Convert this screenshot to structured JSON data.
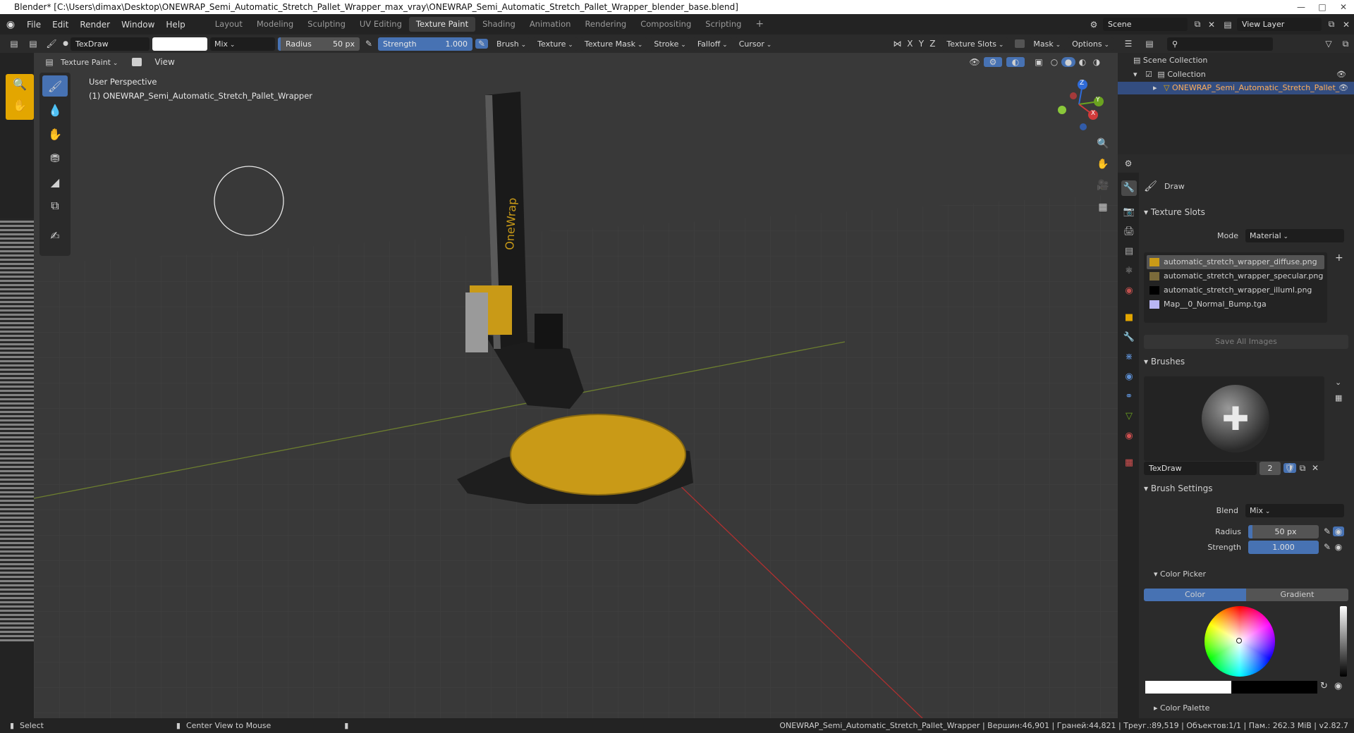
{
  "titlebar": {
    "text": "Blender* [C:\\Users\\dimax\\Desktop\\ONEWRAP_Semi_Automatic_Stretch_Pallet_Wrapper_max_vray\\ONEWRAP_Semi_Automatic_Stretch_Pallet_Wrapper_blender_base.blend]"
  },
  "menus": [
    "File",
    "Edit",
    "Render",
    "Window",
    "Help"
  ],
  "workspaces": [
    "Layout",
    "Modeling",
    "Sculpting",
    "UV Editing",
    "Texture Paint",
    "Shading",
    "Animation",
    "Rendering",
    "Compositing",
    "Scripting"
  ],
  "active_workspace": "Texture Paint",
  "scene": {
    "label": "Scene",
    "view_layer": "View Layer"
  },
  "toolheader": {
    "brush_name": "TexDraw",
    "blend": "Mix",
    "radius_label": "Radius",
    "radius_value": "50 px",
    "strength_label": "Strength",
    "strength_value": "1.000",
    "dropdowns": [
      "Brush",
      "Texture",
      "Texture Mask",
      "Stroke",
      "Falloff",
      "Cursor"
    ],
    "axes": [
      "X",
      "Y",
      "Z"
    ],
    "texture_slots": "Texture Slots",
    "mask": "Mask",
    "options": "Options"
  },
  "viewport_header": {
    "mode": "Texture Paint",
    "view": "View"
  },
  "viewport": {
    "perspective": "User Perspective",
    "object_line": "(1) ONEWRAP_Semi_Automatic_Stretch_Pallet_Wrapper",
    "mast_text": "OneWrap"
  },
  "gizmo": {
    "x": "X",
    "y": "Y",
    "z": "Z"
  },
  "outliner": {
    "scene_collection": "Scene Collection",
    "collection": "Collection",
    "object": "ONEWRAP_Semi_Automatic_Stretch_Pallet_"
  },
  "properties": {
    "tool_name": "Draw",
    "texture_slots_title": "Texture Slots",
    "mode_label": "Mode",
    "mode_value": "Material",
    "slots": [
      "automatic_stretch_wrapper_diffuse.png",
      "automatic_stretch_wrapper_specular.png",
      "automatic_stretch_wrapper_illuml.png",
      "Map__0_Normal_Bump.tga"
    ],
    "save_all": "Save All Images",
    "brushes_title": "Brushes",
    "brush_name": "TexDraw",
    "brush_users": "2",
    "brush_settings_title": "Brush Settings",
    "blend_label": "Blend",
    "blend_value": "Mix",
    "radius_label": "Radius",
    "radius_value": "50 px",
    "strength_label": "Strength",
    "strength_value": "1.000",
    "color_picker_title": "Color Picker",
    "color_tab": "Color",
    "gradient_tab": "Gradient",
    "color_palette_title": "Color Palette"
  },
  "status": {
    "left": "Select",
    "middle": "Center View to Mouse",
    "right": "ONEWRAP_Semi_Automatic_Stretch_Pallet_Wrapper | Вершин:46,901 | Граней:44,821 | Треуг.:89,519 | Объектов:1/1 | Пам.: 262.3 MiB | v2.82.7"
  },
  "colors": {
    "accent": "#4772b3",
    "machine_yellow": "#c99a17",
    "bg_dark": "#232323"
  }
}
